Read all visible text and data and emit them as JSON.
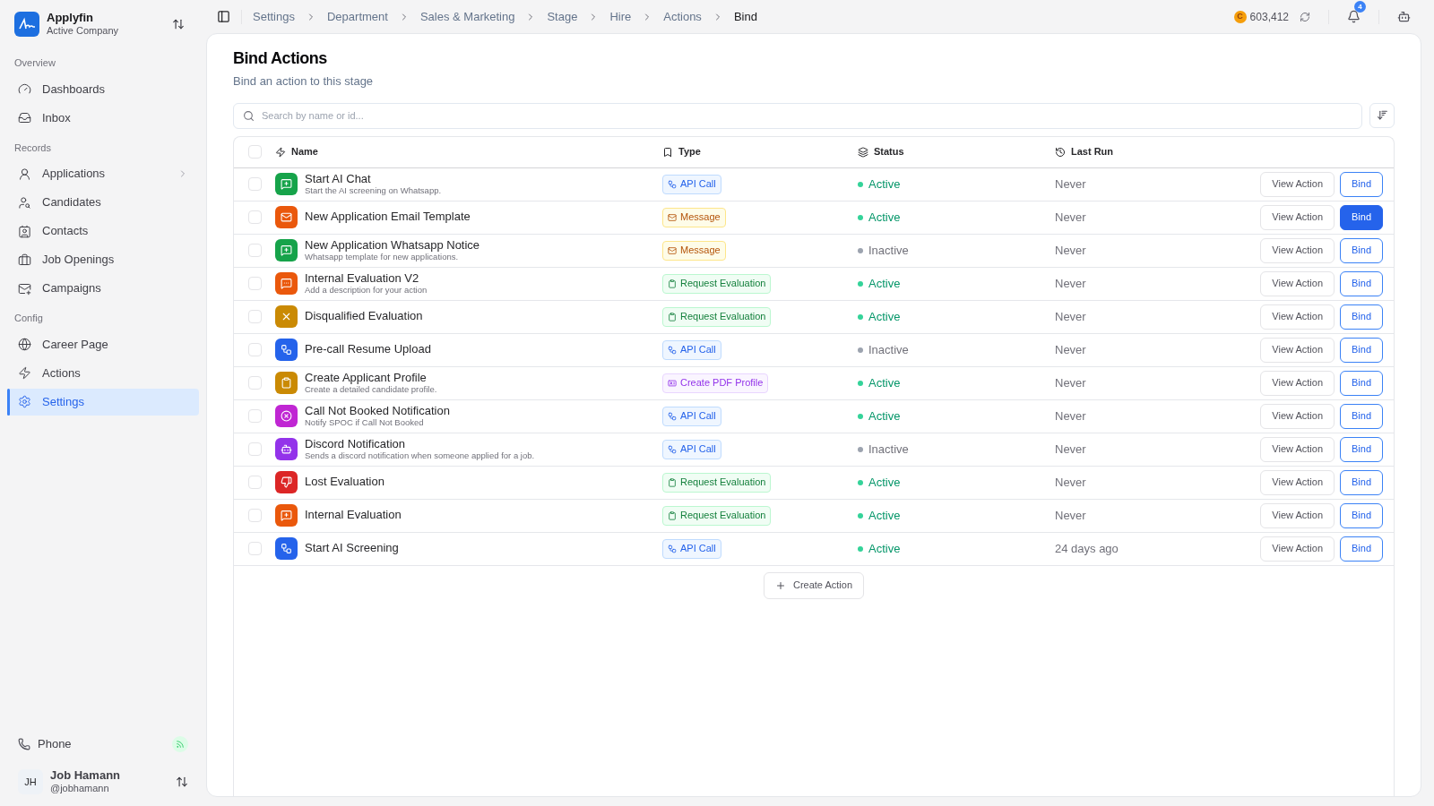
{
  "company": {
    "name": "Applyfin",
    "subtitle": "Active Company"
  },
  "sidebar": {
    "sections": [
      {
        "title": "Overview",
        "items": [
          {
            "label": "Dashboards",
            "selected": false,
            "expandable": false
          },
          {
            "label": "Inbox",
            "selected": false,
            "expandable": false
          }
        ]
      },
      {
        "title": "Records",
        "items": [
          {
            "label": "Applications",
            "selected": false,
            "expandable": true
          },
          {
            "label": "Candidates",
            "selected": false,
            "expandable": false
          },
          {
            "label": "Contacts",
            "selected": false,
            "expandable": false
          },
          {
            "label": "Job Openings",
            "selected": false,
            "expandable": false
          },
          {
            "label": "Campaigns",
            "selected": false,
            "expandable": false
          }
        ]
      },
      {
        "title": "Config",
        "items": [
          {
            "label": "Career Page",
            "selected": false,
            "expandable": false
          },
          {
            "label": "Actions",
            "selected": false,
            "expandable": false
          },
          {
            "label": "Settings",
            "selected": true,
            "expandable": false
          }
        ]
      }
    ],
    "phone": {
      "label": "Phone"
    },
    "user": {
      "initials": "JH",
      "name": "Job Hamann",
      "handle": "@jobhamann"
    }
  },
  "breadcrumbs": [
    "Settings",
    "Department",
    "Sales & Marketing",
    "Stage",
    "Hire",
    "Actions",
    "Bind"
  ],
  "topbar": {
    "coin_symbol": "C",
    "credits": "603,412",
    "notifications": "4"
  },
  "page": {
    "title": "Bind Actions",
    "subtitle": "Bind an action to this stage"
  },
  "search": {
    "placeholder": "Search by name or id..."
  },
  "table": {
    "select_all": {
      "checked": false
    },
    "columns": [
      "Name",
      "Type",
      "Status",
      "Last Run"
    ],
    "rows": [
      {
        "name": "Start AI Chat",
        "description": "Start the AI screening on Whatsapp.",
        "color": "#16a34a",
        "type": {
          "kind": "api",
          "label": "API Call"
        },
        "status": {
          "active": true,
          "label": "Active"
        },
        "last_run": "Never",
        "view": "View Action",
        "bind": "Bind",
        "selected": false,
        "checked": false
      },
      {
        "name": "New Application Email Template",
        "color": "#ea580c",
        "type": {
          "kind": "message",
          "label": "Message"
        },
        "status": {
          "active": true,
          "label": "Active"
        },
        "last_run": "Never",
        "view": "View Action",
        "bind": "Bind",
        "selected": true,
        "checked": false
      },
      {
        "name": "New Application Whatsapp Notice",
        "description": "Whatsapp template for new applications.",
        "color": "#16a34a",
        "type": {
          "kind": "message",
          "label": "Message"
        },
        "status": {
          "active": false,
          "label": "Inactive"
        },
        "last_run": "Never",
        "view": "View Action",
        "bind": "Bind",
        "selected": false,
        "checked": false
      },
      {
        "name": "Internal Evaluation V2",
        "description": "Add a description for your action",
        "color": "#ea580c",
        "type": {
          "kind": "evaluation",
          "label": "Request Evaluation"
        },
        "status": {
          "active": true,
          "label": "Active"
        },
        "last_run": "Never",
        "view": "View Action",
        "bind": "Bind",
        "selected": false,
        "checked": false
      },
      {
        "name": "Disqualified Evaluation",
        "color": "#ca8a04",
        "type": {
          "kind": "evaluation",
          "label": "Request Evaluation"
        },
        "status": {
          "active": true,
          "label": "Active"
        },
        "last_run": "Never",
        "view": "View Action",
        "bind": "Bind",
        "selected": false,
        "checked": false
      },
      {
        "name": "Pre-call Resume Upload",
        "color": "#2563eb",
        "type": {
          "kind": "api",
          "label": "API Call"
        },
        "status": {
          "active": false,
          "label": "Inactive"
        },
        "last_run": "Never",
        "view": "View Action",
        "bind": "Bind",
        "selected": false,
        "checked": false
      },
      {
        "name": "Create Applicant Profile",
        "description": "Create a detailed candidate profile.",
        "color": "#ca8a04",
        "type": {
          "kind": "pdf",
          "label": "Create PDF Profile"
        },
        "status": {
          "active": true,
          "label": "Active"
        },
        "last_run": "Never",
        "view": "View Action",
        "bind": "Bind",
        "selected": false,
        "checked": false
      },
      {
        "name": "Call Not Booked Notification",
        "description": "Notify SPOC if Call Not Booked",
        "color": "#c026d3",
        "type": {
          "kind": "api",
          "label": "API Call"
        },
        "status": {
          "active": true,
          "label": "Active"
        },
        "last_run": "Never",
        "view": "View Action",
        "bind": "Bind",
        "selected": false,
        "checked": false
      },
      {
        "name": "Discord Notification",
        "description": "Sends a discord notification when someone applied for a job.",
        "color": "#9333ea",
        "type": {
          "kind": "api",
          "label": "API Call"
        },
        "status": {
          "active": false,
          "label": "Inactive"
        },
        "last_run": "Never",
        "view": "View Action",
        "bind": "Bind",
        "selected": false,
        "checked": false
      },
      {
        "name": "Lost Evaluation",
        "color": "#dc2626",
        "type": {
          "kind": "evaluation",
          "label": "Request Evaluation"
        },
        "status": {
          "active": true,
          "label": "Active"
        },
        "last_run": "Never",
        "view": "View Action",
        "bind": "Bind",
        "selected": false,
        "checked": false
      },
      {
        "name": "Internal Evaluation",
        "color": "#ea580c",
        "type": {
          "kind": "evaluation",
          "label": "Request Evaluation"
        },
        "status": {
          "active": true,
          "label": "Active"
        },
        "last_run": "Never",
        "view": "View Action",
        "bind": "Bind",
        "selected": false,
        "checked": false
      },
      {
        "name": "Start AI Screening",
        "color": "#2563eb",
        "type": {
          "kind": "api",
          "label": "API Call"
        },
        "status": {
          "active": true,
          "label": "Active"
        },
        "last_run": "24 days ago",
        "view": "View Action",
        "bind": "Bind",
        "selected": false,
        "checked": false
      }
    ]
  },
  "create_button": "Create Action"
}
